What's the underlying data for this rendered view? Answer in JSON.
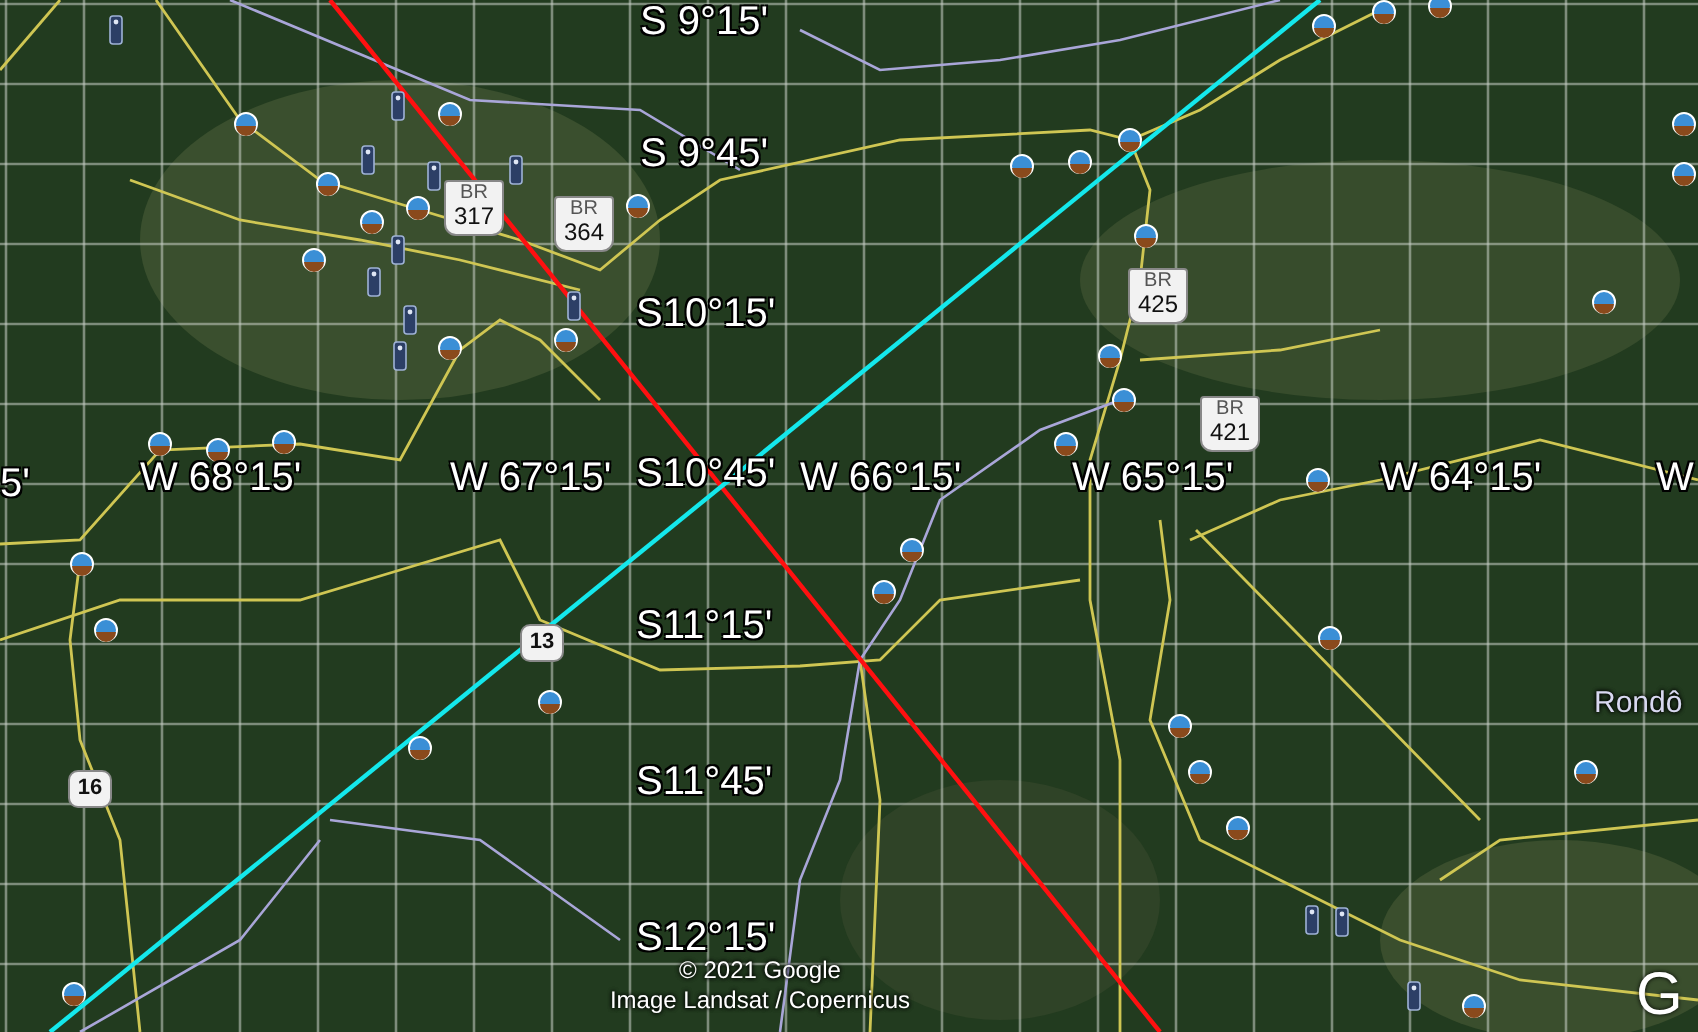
{
  "map": {
    "grid_labels": [
      {
        "text": "S 9°15'"
      },
      {
        "text": "S 9°45'"
      },
      {
        "text": "S10°15'"
      },
      {
        "text": "5'"
      },
      {
        "text": "W 68°15'"
      },
      {
        "text": "W 67°15'"
      },
      {
        "text": "S10°45'"
      },
      {
        "text": "W 66°15'"
      },
      {
        "text": "W 65°15'"
      },
      {
        "text": "W 64°15'"
      },
      {
        "text": "W"
      },
      {
        "text": "S11°15'"
      },
      {
        "text": "S11°45'"
      },
      {
        "text": "S12°15'"
      }
    ],
    "shields": [
      {
        "kind": "br",
        "network": "BR",
        "number": "317"
      },
      {
        "kind": "br",
        "network": "BR",
        "number": "364"
      },
      {
        "kind": "br",
        "network": "BR",
        "number": "425"
      },
      {
        "kind": "br",
        "network": "BR",
        "number": "421"
      },
      {
        "kind": "plain",
        "number": "13"
      },
      {
        "kind": "plain",
        "number": "16"
      }
    ],
    "region_label": "Rondô",
    "attribution": [
      "© 2021 Google",
      "Image Landsat / Copernicus"
    ],
    "logo": "G"
  }
}
